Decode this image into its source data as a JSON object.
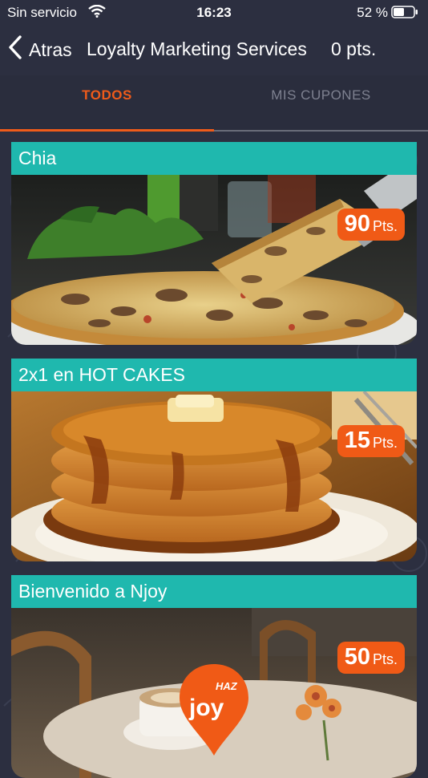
{
  "status_bar": {
    "carrier": "Sin servicio",
    "time": "16:23",
    "battery_percent": "52 %"
  },
  "nav": {
    "back_label": "Atras",
    "title": "Loyalty Marketing Services",
    "points": "0 pts."
  },
  "tabs": {
    "todos": "TODOS",
    "mis_cupones": "MIS CUPONES"
  },
  "coupons": [
    {
      "title": "Chia",
      "points": "90",
      "unit": "Pts."
    },
    {
      "title": "2x1 en HOT CAKES",
      "points": "15",
      "unit": "Pts."
    },
    {
      "title": "Bienvenido a Njoy",
      "points": "50",
      "unit": "Pts."
    }
  ],
  "fab": {
    "logo_top": "HAZ",
    "logo_bottom": "joy"
  },
  "colors": {
    "accent": "#ef5b1a",
    "card_header": "#1fb8ae",
    "background": "#2c2f40"
  }
}
